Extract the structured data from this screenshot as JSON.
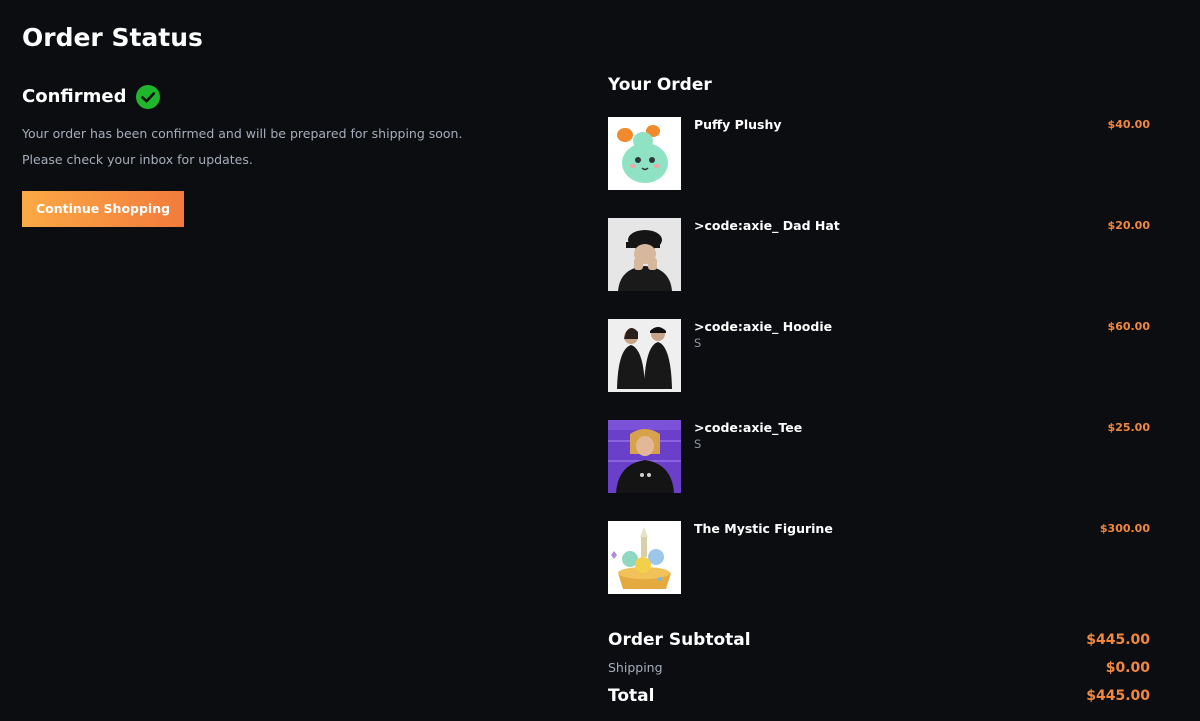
{
  "page": {
    "title": "Order Status"
  },
  "status": {
    "label": "Confirmed",
    "icon": "check-circle-icon",
    "color": "#1fb62c",
    "message_line1": "Your order has been confirmed and will be prepared for shipping soon.",
    "message_line2": "Please check your inbox for updates."
  },
  "actions": {
    "continue_label": "Continue Shopping"
  },
  "order": {
    "title": "Your Order",
    "items": [
      {
        "name": "Puffy Plushy",
        "variant": "",
        "price": "$40.00",
        "image": "green-plush-toy"
      },
      {
        "name": ">code:axie_ Dad Hat",
        "variant": "",
        "price": "$20.00",
        "image": "person-wearing-black-cap"
      },
      {
        "name": ">code:axie_ Hoodie",
        "variant": "S",
        "price": "$60.00",
        "image": "two-people-in-black-hoodies"
      },
      {
        "name": ">code:axie_Tee",
        "variant": "S",
        "price": "$25.00",
        "image": "person-in-black-tee-purple-background"
      },
      {
        "name": "The Mystic Figurine",
        "variant": "",
        "price": "$300.00",
        "image": "mystic-figurine"
      }
    ]
  },
  "totals": {
    "subtotal_label": "Order Subtotal",
    "subtotal_value": "$445.00",
    "shipping_label": "Shipping",
    "shipping_value": "$0.00",
    "total_label": "Total",
    "total_value": "$445.00"
  },
  "colors": {
    "background": "#0c0d11",
    "accent": "#f2883f",
    "button_gradient_start": "#fba945",
    "button_gradient_end": "#f27b3c",
    "muted_text": "#a7adbb"
  }
}
